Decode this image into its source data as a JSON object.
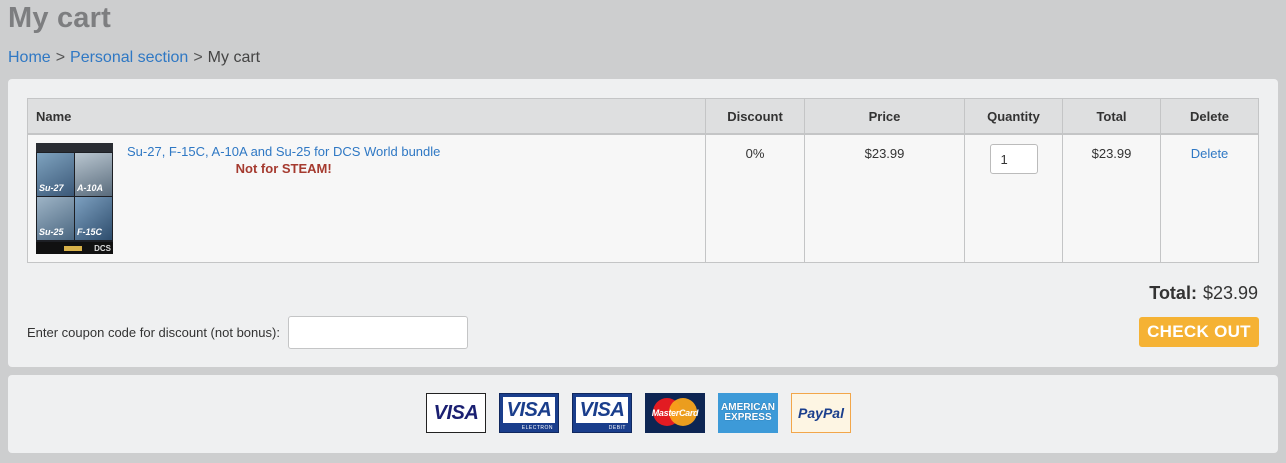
{
  "page": {
    "title": "My cart"
  },
  "breadcrumb": {
    "items": [
      "Home",
      "Personal section"
    ],
    "current": "My cart",
    "separator": ">"
  },
  "table": {
    "headers": {
      "name": "Name",
      "discount": "Discount",
      "price": "Price",
      "quantity": "Quantity",
      "total": "Total",
      "delete": "Delete"
    },
    "rows": [
      {
        "name": "Su-27, F-15C, A-10A and Su-25 for DCS World bundle",
        "note": "Not for STEAM!",
        "thumb_labels": [
          "Su-27",
          "A-10A",
          "Su-25",
          "F-15C"
        ],
        "thumb_footer": "DCS",
        "discount": "0%",
        "price": "$23.99",
        "quantity": "1",
        "total": "$23.99",
        "delete": "Delete"
      }
    ]
  },
  "summary": {
    "total_label": "Total:",
    "total_value": "$23.99",
    "checkout_label": "CHECK OUT"
  },
  "coupon": {
    "label": "Enter coupon code for discount (not bonus):",
    "value": ""
  },
  "payments": {
    "visa": "VISA",
    "visa_electron": "VISA",
    "visa_electron_sub": "ELECTRON",
    "visa_debit": "VISA",
    "visa_debit_sub": "DEBIT",
    "mastercard": "MasterCard",
    "amex_line1": "AMERICAN",
    "amex_line2": "EXPRESS",
    "paypal": "PayPal"
  },
  "colors": {
    "link": "#2f78c4",
    "warning": "#a53a2f",
    "checkout": "#f5b234",
    "background": "#cdcecf",
    "panel": "#eff0f1"
  }
}
